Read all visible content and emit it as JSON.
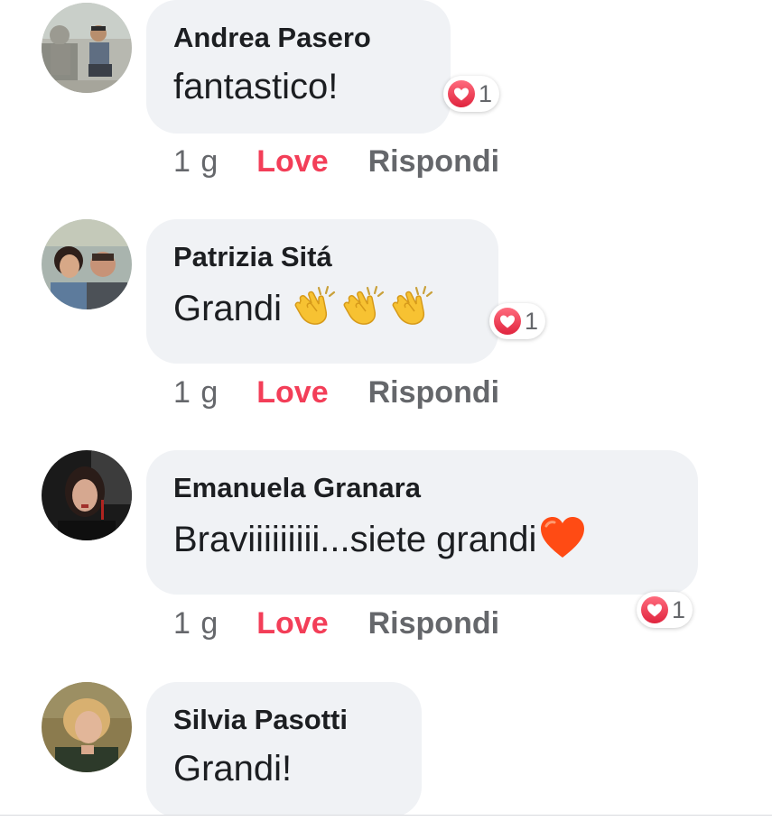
{
  "comments": [
    {
      "author": "Andrea Pasero",
      "text": "fantastico!",
      "reaction_icon": "heart-reaction-icon",
      "reaction_count": "1",
      "time": "1 g",
      "love_label": "Love",
      "reply_label": "Rispondi"
    },
    {
      "author": "Patrizia Sitá",
      "text": "Grandi ",
      "emoji": "clapping-hands-icon",
      "reaction_icon": "heart-reaction-icon",
      "reaction_count": "1",
      "time": "1 g",
      "love_label": "Love",
      "reply_label": "Rispondi"
    },
    {
      "author": "Emanuela Granara",
      "text": "Braviiiiiiiii...siete grandi",
      "emoji": "orange-heart-icon",
      "reaction_icon": "heart-reaction-icon",
      "reaction_count": "1",
      "time": "1 g",
      "love_label": "Love",
      "reply_label": "Rispondi"
    },
    {
      "author": "Silvia Pasotti",
      "text": "Grandi!"
    }
  ],
  "colors": {
    "bubble": "#f0f2f5",
    "love": "#f33e58",
    "meta": "#65676b",
    "reaction_red": "#f33e58"
  }
}
